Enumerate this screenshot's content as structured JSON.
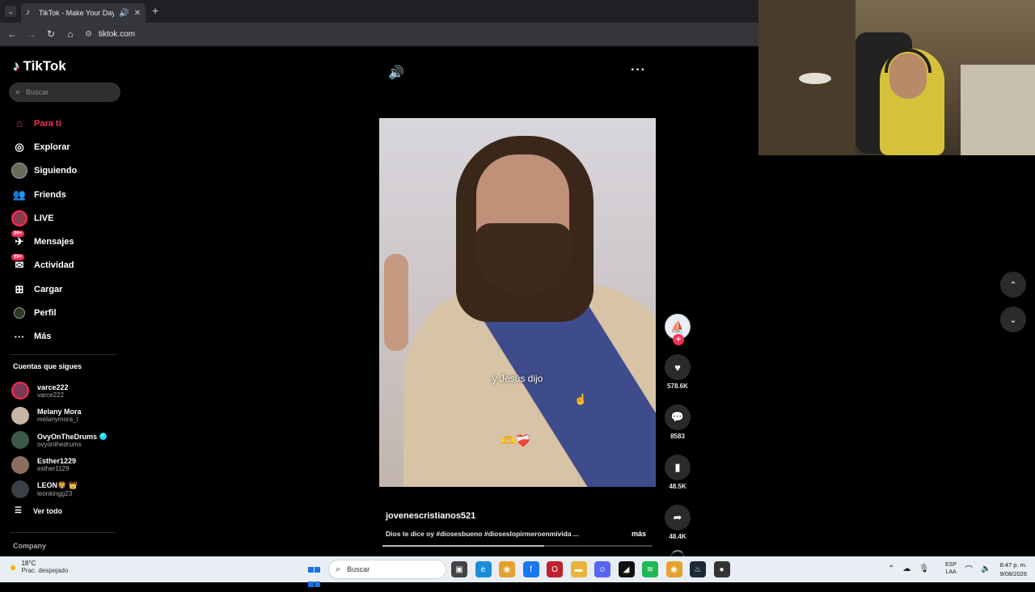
{
  "browser": {
    "tab_title": "TikTok - Make Your Day",
    "url": "tiktok.com"
  },
  "sidebar": {
    "logo": "TikTok",
    "search_placeholder": "Buscar",
    "nav": [
      {
        "label": "Para ti",
        "icon": "home-icon",
        "active": true
      },
      {
        "label": "Explorar",
        "icon": "compass-icon"
      },
      {
        "label": "Siguiendo",
        "icon": "following-avatar"
      },
      {
        "label": "Friends",
        "icon": "friends-icon"
      },
      {
        "label": "LIVE",
        "icon": "live-avatar"
      },
      {
        "label": "Mensajes",
        "icon": "messages-icon",
        "badge": "99+"
      },
      {
        "label": "Actividad",
        "icon": "activity-icon",
        "badge": "99+"
      },
      {
        "label": "Cargar",
        "icon": "upload-icon"
      },
      {
        "label": "Perfil",
        "icon": "profile-avatar"
      },
      {
        "label": "Más",
        "icon": "more-icon"
      }
    ],
    "following_title": "Cuentas que sigues",
    "following": [
      {
        "name": "varce222",
        "handle": "varce222"
      },
      {
        "name": "Melany Mora",
        "handle": "melanymora_l"
      },
      {
        "name": "OvyOnTheDrums",
        "handle": "ovyonthedrums",
        "verified": true
      },
      {
        "name": "Esther1229",
        "handle": "esther1129"
      },
      {
        "name": "LEON🦁 👑",
        "handle": "leonkingg23"
      }
    ],
    "see_all": "Ver todo",
    "company": "Company"
  },
  "video": {
    "caption": "y Jesús dijo",
    "emojis": "🫶❤️‍🩹",
    "author": "jovenescristianos521",
    "description": "Dios te dice oy #diosesbueno #dioseslopirmeroenmivida ...",
    "more": "más",
    "progress": 0.6,
    "likes": "578.6K",
    "comments": "8583",
    "saves": "48.5K",
    "shares": "48.4K"
  },
  "taskbar": {
    "weather_temp": "18°C",
    "weather_desc": "Prac. despejado",
    "search": "Buscar",
    "lang_top": "ESP",
    "lang_bottom": "LAA",
    "time": "8:47 p. m.",
    "date": "9/08/2026"
  },
  "colors": {
    "accent": "#fe2c55",
    "background": "#000000",
    "taskbar": "#e9eef5"
  }
}
